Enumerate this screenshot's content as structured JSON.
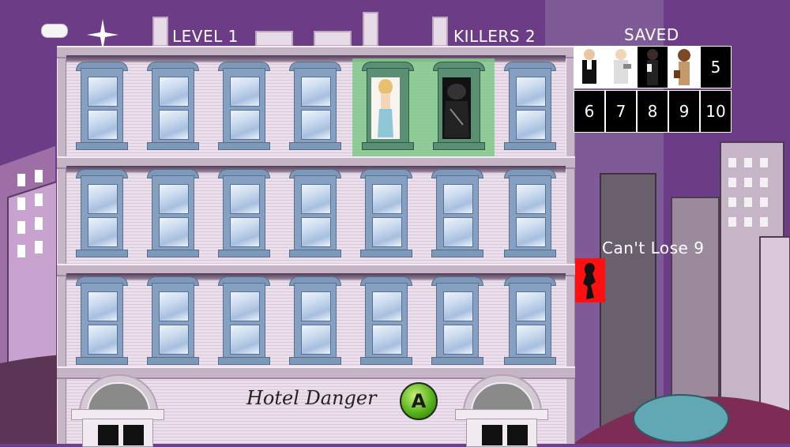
{
  "game": {
    "level_label": "LEVEL 1",
    "killers_label": "KILLERS 2",
    "saved_label": "SAVED",
    "cant_lose_label": "Can't Lose 9",
    "sign_text": "Hotel Danger",
    "a_button_label": "A"
  },
  "saved_slots": {
    "top_numbers": [
      "5"
    ],
    "bottom_numbers": [
      "6",
      "7",
      "8",
      "9",
      "10"
    ]
  },
  "icons": {
    "back": "back-icon",
    "sparkle": "sparkle-icon",
    "a_button": "a-button-icon"
  },
  "colors": {
    "sky": "#6d3f86",
    "highlight": "#7fc98a",
    "red_alert": "#ff1010"
  }
}
